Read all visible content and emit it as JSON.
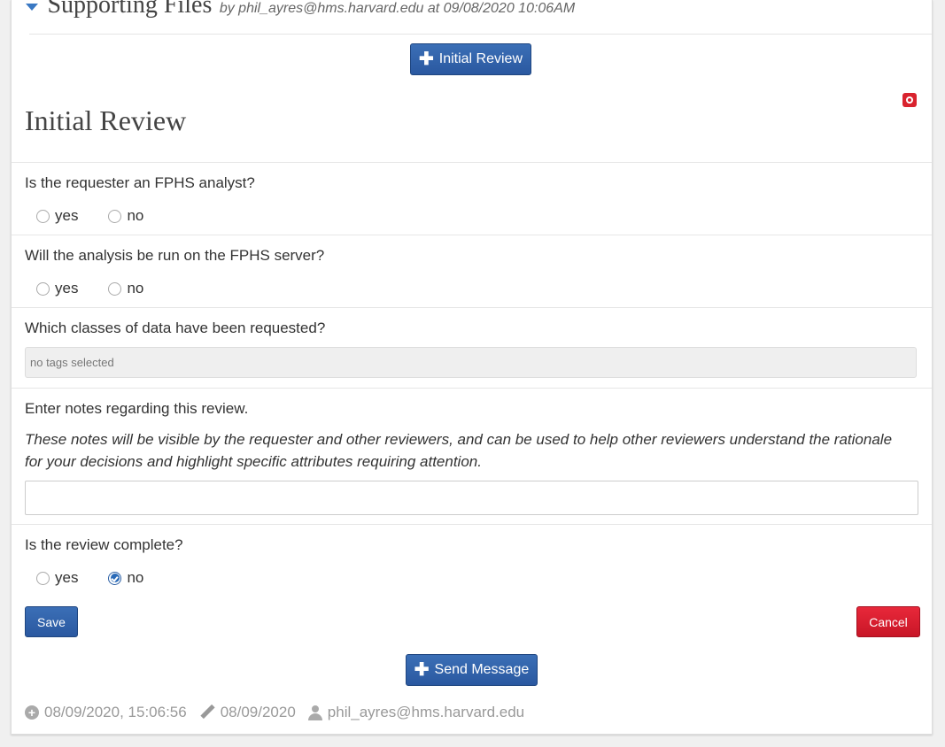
{
  "header": {
    "title": "Supporting Files",
    "byline": "by phil_ayres@hms.harvard.edu at 09/08/2020 10:06AM"
  },
  "initial_review_button": "Initial Review",
  "section": {
    "title": "Initial Review"
  },
  "questions": {
    "q1": {
      "label": "Is the requester an FPHS analyst?",
      "yes": "yes",
      "no": "no",
      "selected": null
    },
    "q2": {
      "label": "Will the analysis be run on the FPHS server?",
      "yes": "yes",
      "no": "no",
      "selected": null
    },
    "q3": {
      "label": "Which classes of data have been requested?",
      "placeholder": "no tags selected"
    },
    "notes": {
      "label": "Enter notes regarding this review.",
      "help": "These notes will be visible by the requester and other reviewers, and can be used to help other reviewers understand the rationale for your decisions and highlight specific attributes requiring attention.",
      "value": ""
    },
    "complete": {
      "label": "Is the review complete?",
      "yes": "yes",
      "no": "no",
      "selected": "no"
    }
  },
  "actions": {
    "save": "Save",
    "cancel": "Cancel",
    "send_message": "Send Message"
  },
  "footer": {
    "created": "08/09/2020, 15:06:56",
    "updated": "08/09/2020",
    "user": "phil_ayres@hms.harvard.edu"
  },
  "colors": {
    "primary": "#2a58a0",
    "danger": "#c81627",
    "accent": "#3a78c3"
  },
  "icons": {
    "collapse": "caret-down-icon",
    "close": "close-icon",
    "plus": "plus-icon",
    "created": "plus-circle-icon",
    "updated": "pencil-icon",
    "user": "user-icon"
  }
}
